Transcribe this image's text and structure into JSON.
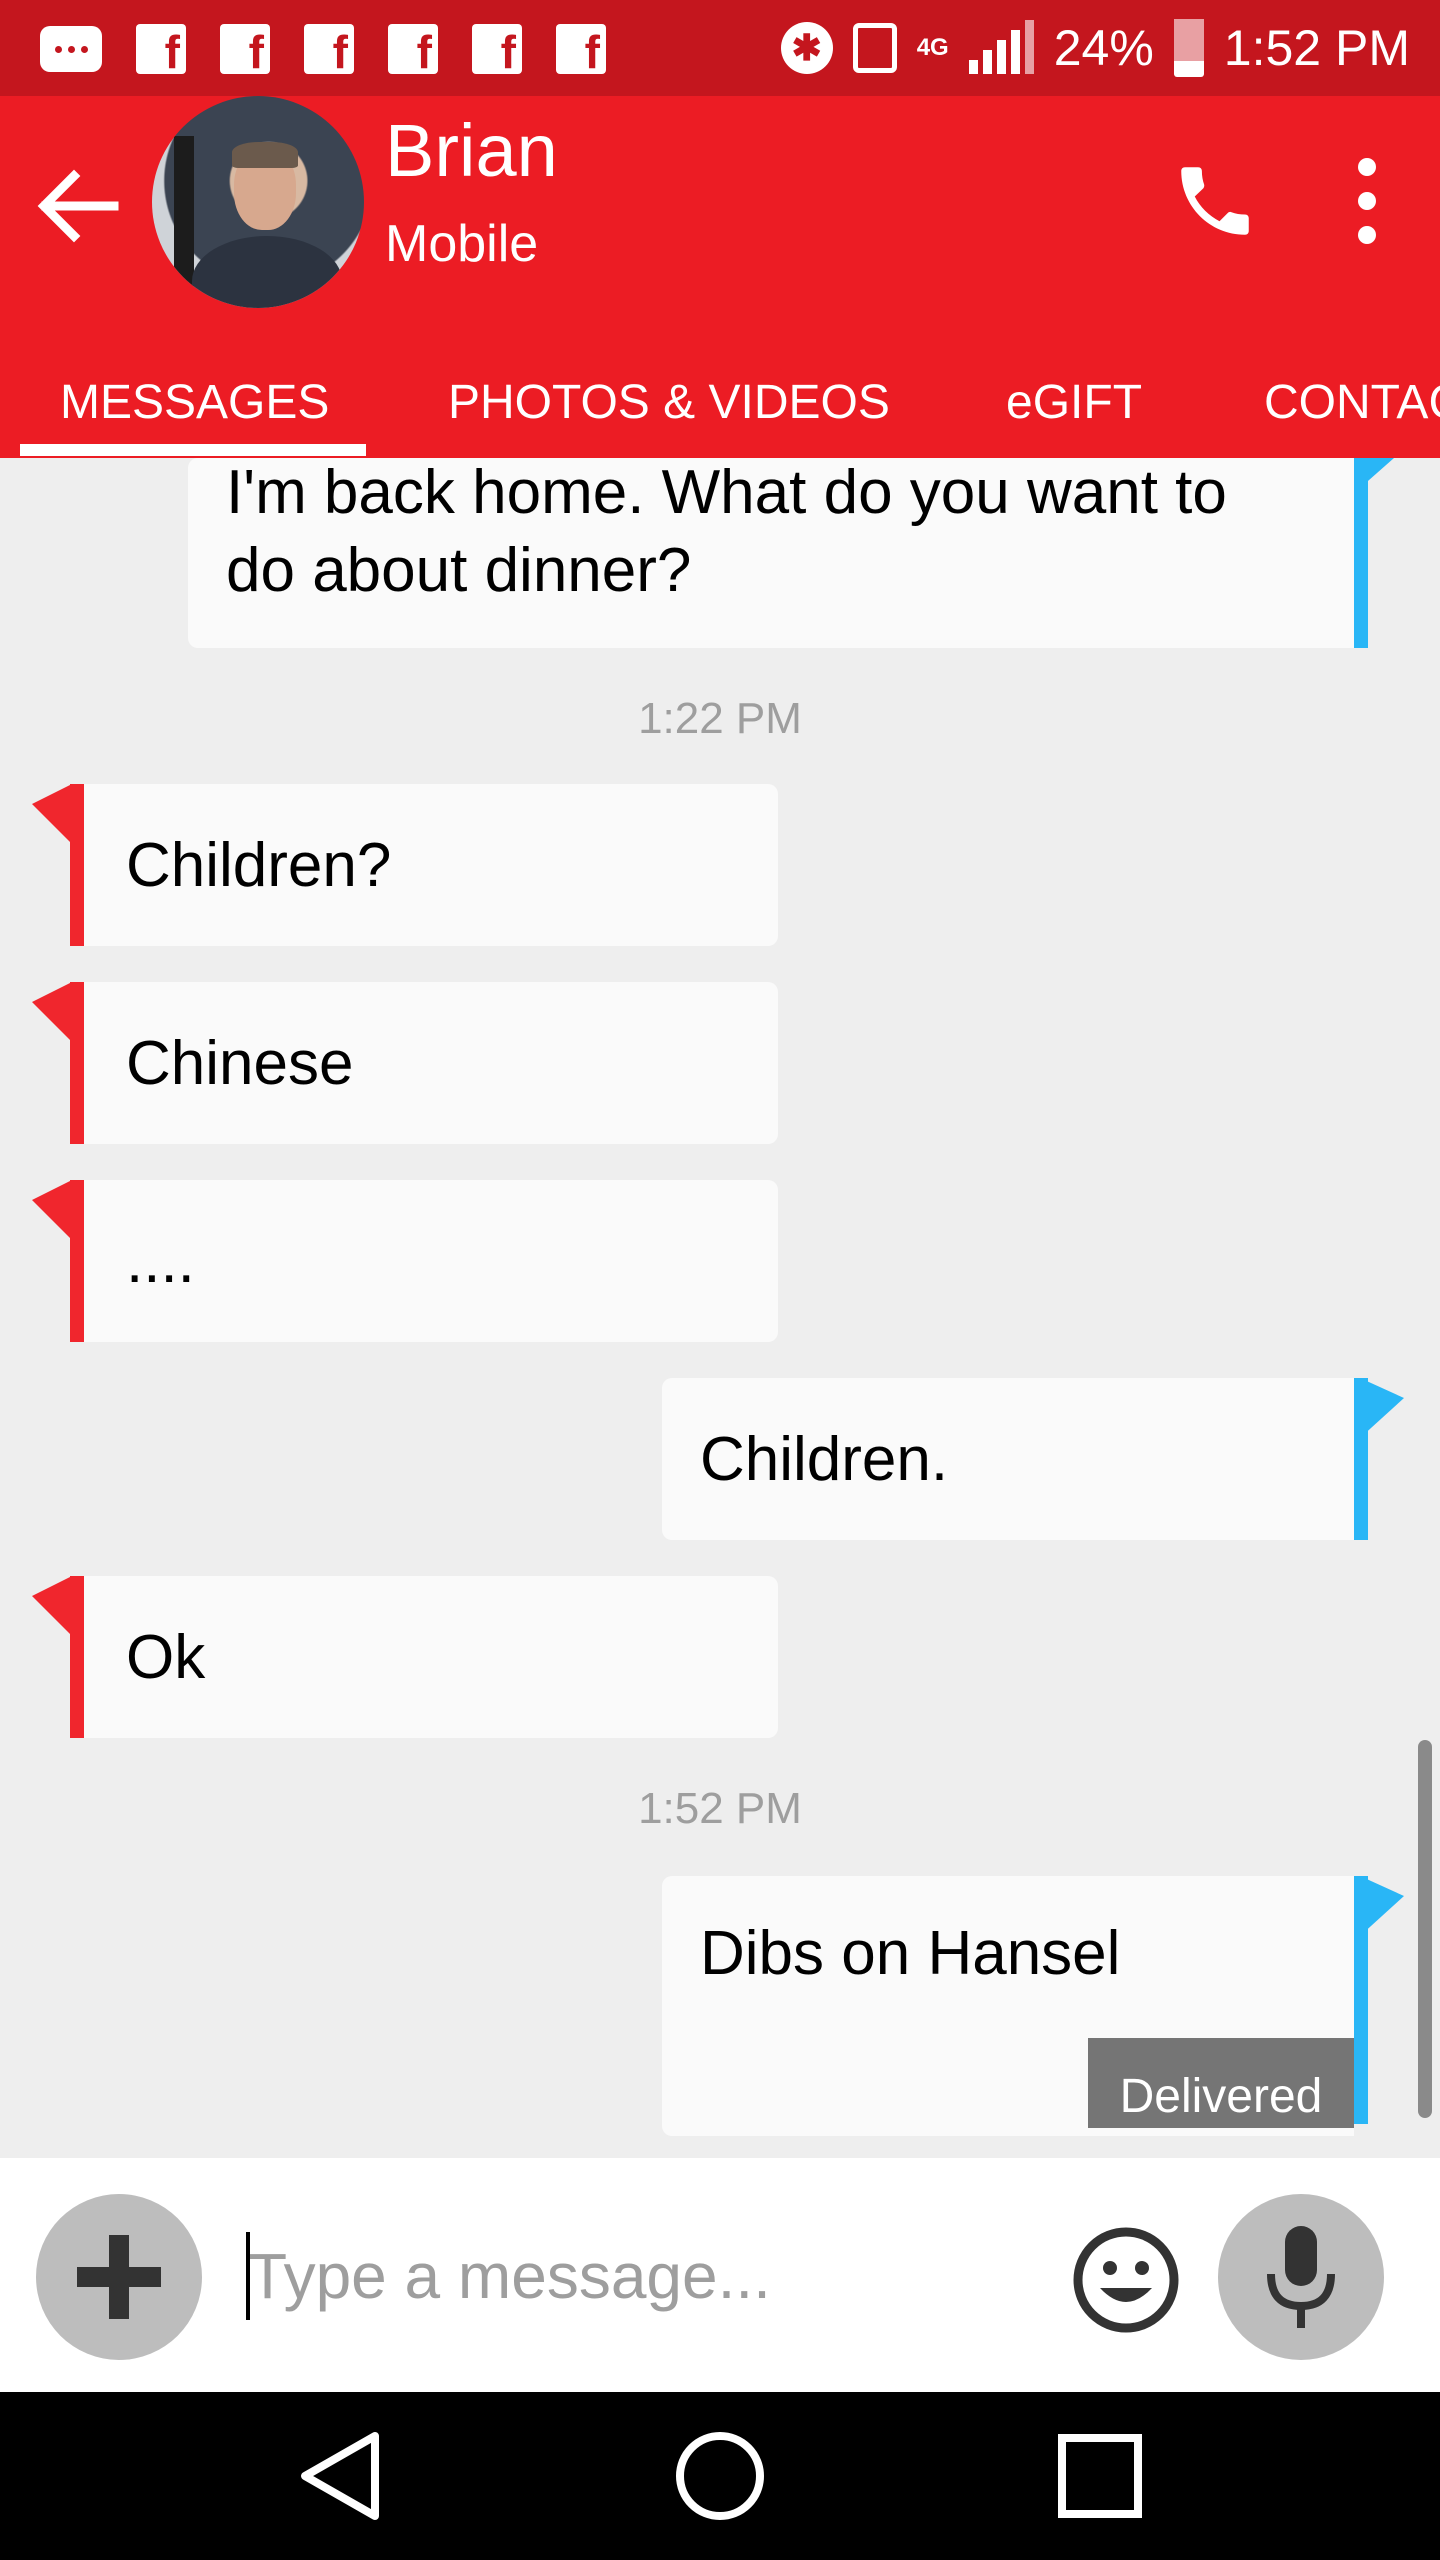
{
  "status_bar": {
    "notification_icons": [
      "message-icon",
      "facebook-icon",
      "facebook-icon",
      "facebook-icon",
      "facebook-icon",
      "facebook-icon",
      "facebook-icon"
    ],
    "network": "4G",
    "battery": "24%",
    "time": "1:52 PM"
  },
  "header": {
    "contact_name": "Brian",
    "contact_type": "Mobile"
  },
  "tabs": [
    {
      "label": "MESSAGES",
      "selected": true
    },
    {
      "label": "PHOTOS & VIDEOS",
      "selected": false
    },
    {
      "label": "eGIFT",
      "selected": false
    },
    {
      "label": "CONTAC",
      "selected": false
    }
  ],
  "conversation": {
    "messages": [
      {
        "direction": "outgoing",
        "lines": [
          "I'm back home. What do you want to",
          "do about dinner?"
        ]
      },
      {
        "timestamp": "1:22 PM"
      },
      {
        "direction": "incoming",
        "text": "Children?"
      },
      {
        "direction": "incoming",
        "text": "Chinese"
      },
      {
        "direction": "incoming",
        "text": "...."
      },
      {
        "direction": "outgoing",
        "text": "Children."
      },
      {
        "direction": "incoming",
        "text": "Ok"
      },
      {
        "timestamp": "1:52 PM"
      },
      {
        "direction": "outgoing",
        "text": "Dibs on Hansel",
        "status": "Delivered"
      }
    ]
  },
  "composer": {
    "placeholder": "Type a message..."
  },
  "colors": {
    "status_bar": "#c4161e",
    "app_bar": "#ec1c24",
    "incoming_accent": "#f0262d",
    "outgoing_accent": "#29b6f6"
  }
}
